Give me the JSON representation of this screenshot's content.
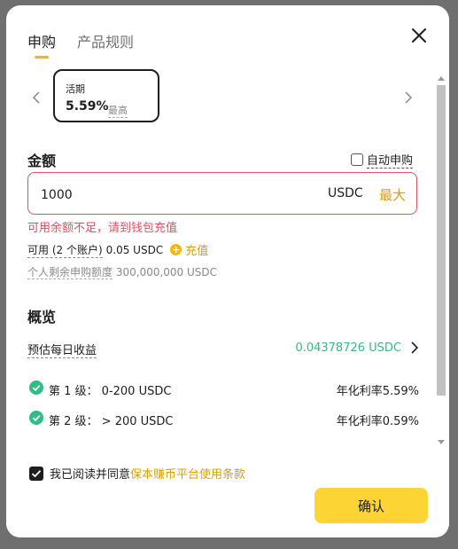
{
  "tabs": [
    {
      "label": "申购",
      "active": true
    },
    {
      "label": "产品规则",
      "active": false
    }
  ],
  "term_card": {
    "label": "活期",
    "rate": "5.59%",
    "max_tag": "最高"
  },
  "amount": {
    "label": "金额",
    "auto_subscribe": "自动申购",
    "value": "1000",
    "currency": "USDC",
    "max_button": "最大",
    "error": "可用余额不足，请到钱包充值",
    "available_label": "可用 (2 个账户)",
    "available_value": "0.05 USDC",
    "recharge": "充值",
    "quota_label": "个人剩余申购额度",
    "quota_value": "300,000,000 USDC"
  },
  "overview": {
    "title": "概览",
    "daily_label": "预估每日收益",
    "daily_value": "0.04378726 USDC",
    "tiers": [
      {
        "label": "第 1 级：  0-200 USDC",
        "rate": "年化利率5.59%"
      },
      {
        "label": "第 2 级：  > 200 USDC",
        "rate": "年化利率0.59%"
      }
    ]
  },
  "agreement": {
    "prefix": "我已阅读并同意",
    "link": "保本赚币平台使用条款",
    "checked": true
  },
  "confirm_button": "确认",
  "colors": {
    "accent": "#f0b90b",
    "error": "#e24f63",
    "success": "#2ebd85",
    "button": "#fcd535"
  }
}
